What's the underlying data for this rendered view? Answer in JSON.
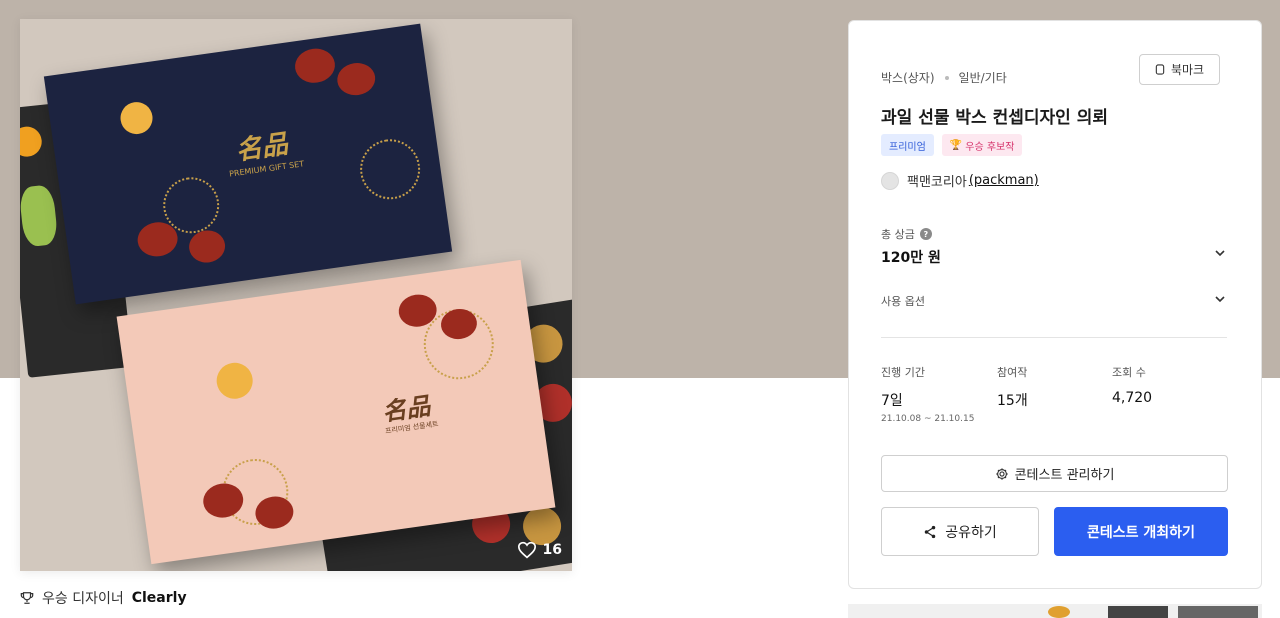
{
  "gallery": {
    "likes": "16",
    "box_top_label": "PREMIUM GIFT SET",
    "box_top_label_ko": "프리미엄 선물세트",
    "box_logo": "名品"
  },
  "award": {
    "prefix": "우승 디자이너",
    "designer": "Clearly"
  },
  "panel": {
    "breadcrumb": [
      "박스(상자)",
      "일반/기타"
    ],
    "bookmark_label": "북마크",
    "title": "과일 선물 박스 컨셉디자인 의뢰",
    "badges": {
      "premium": "프리미엄",
      "winner": "우승 후보작"
    },
    "owner": {
      "name": "팩맨코리아",
      "handle": "(packman)"
    },
    "prize": {
      "label": "총 상금",
      "help": "?",
      "value": "120만 원"
    },
    "usage": {
      "label": "사용 옵션"
    },
    "stats": {
      "period": {
        "label": "진행 기간",
        "value": "7일",
        "range": "21.10.08 ~ 21.10.15"
      },
      "entries": {
        "label": "참여작",
        "value": "15개"
      },
      "views": {
        "label": "조회 수",
        "value": "4,720"
      }
    },
    "manage_label": "콘테스트 관리하기",
    "share_label": "공유하기",
    "host_label": "콘테스트 개최하기"
  },
  "colors": {
    "hero_bg": "#bdb3a9",
    "primary": "#2b5ef0",
    "premium_badge": "#2f5bd8",
    "winner_badge": "#d6336c"
  },
  "icons": [
    "heart-icon",
    "trophy-icon",
    "bookmark-icon",
    "help-icon",
    "chevron-down-icon",
    "gear-icon",
    "share-icon"
  ]
}
